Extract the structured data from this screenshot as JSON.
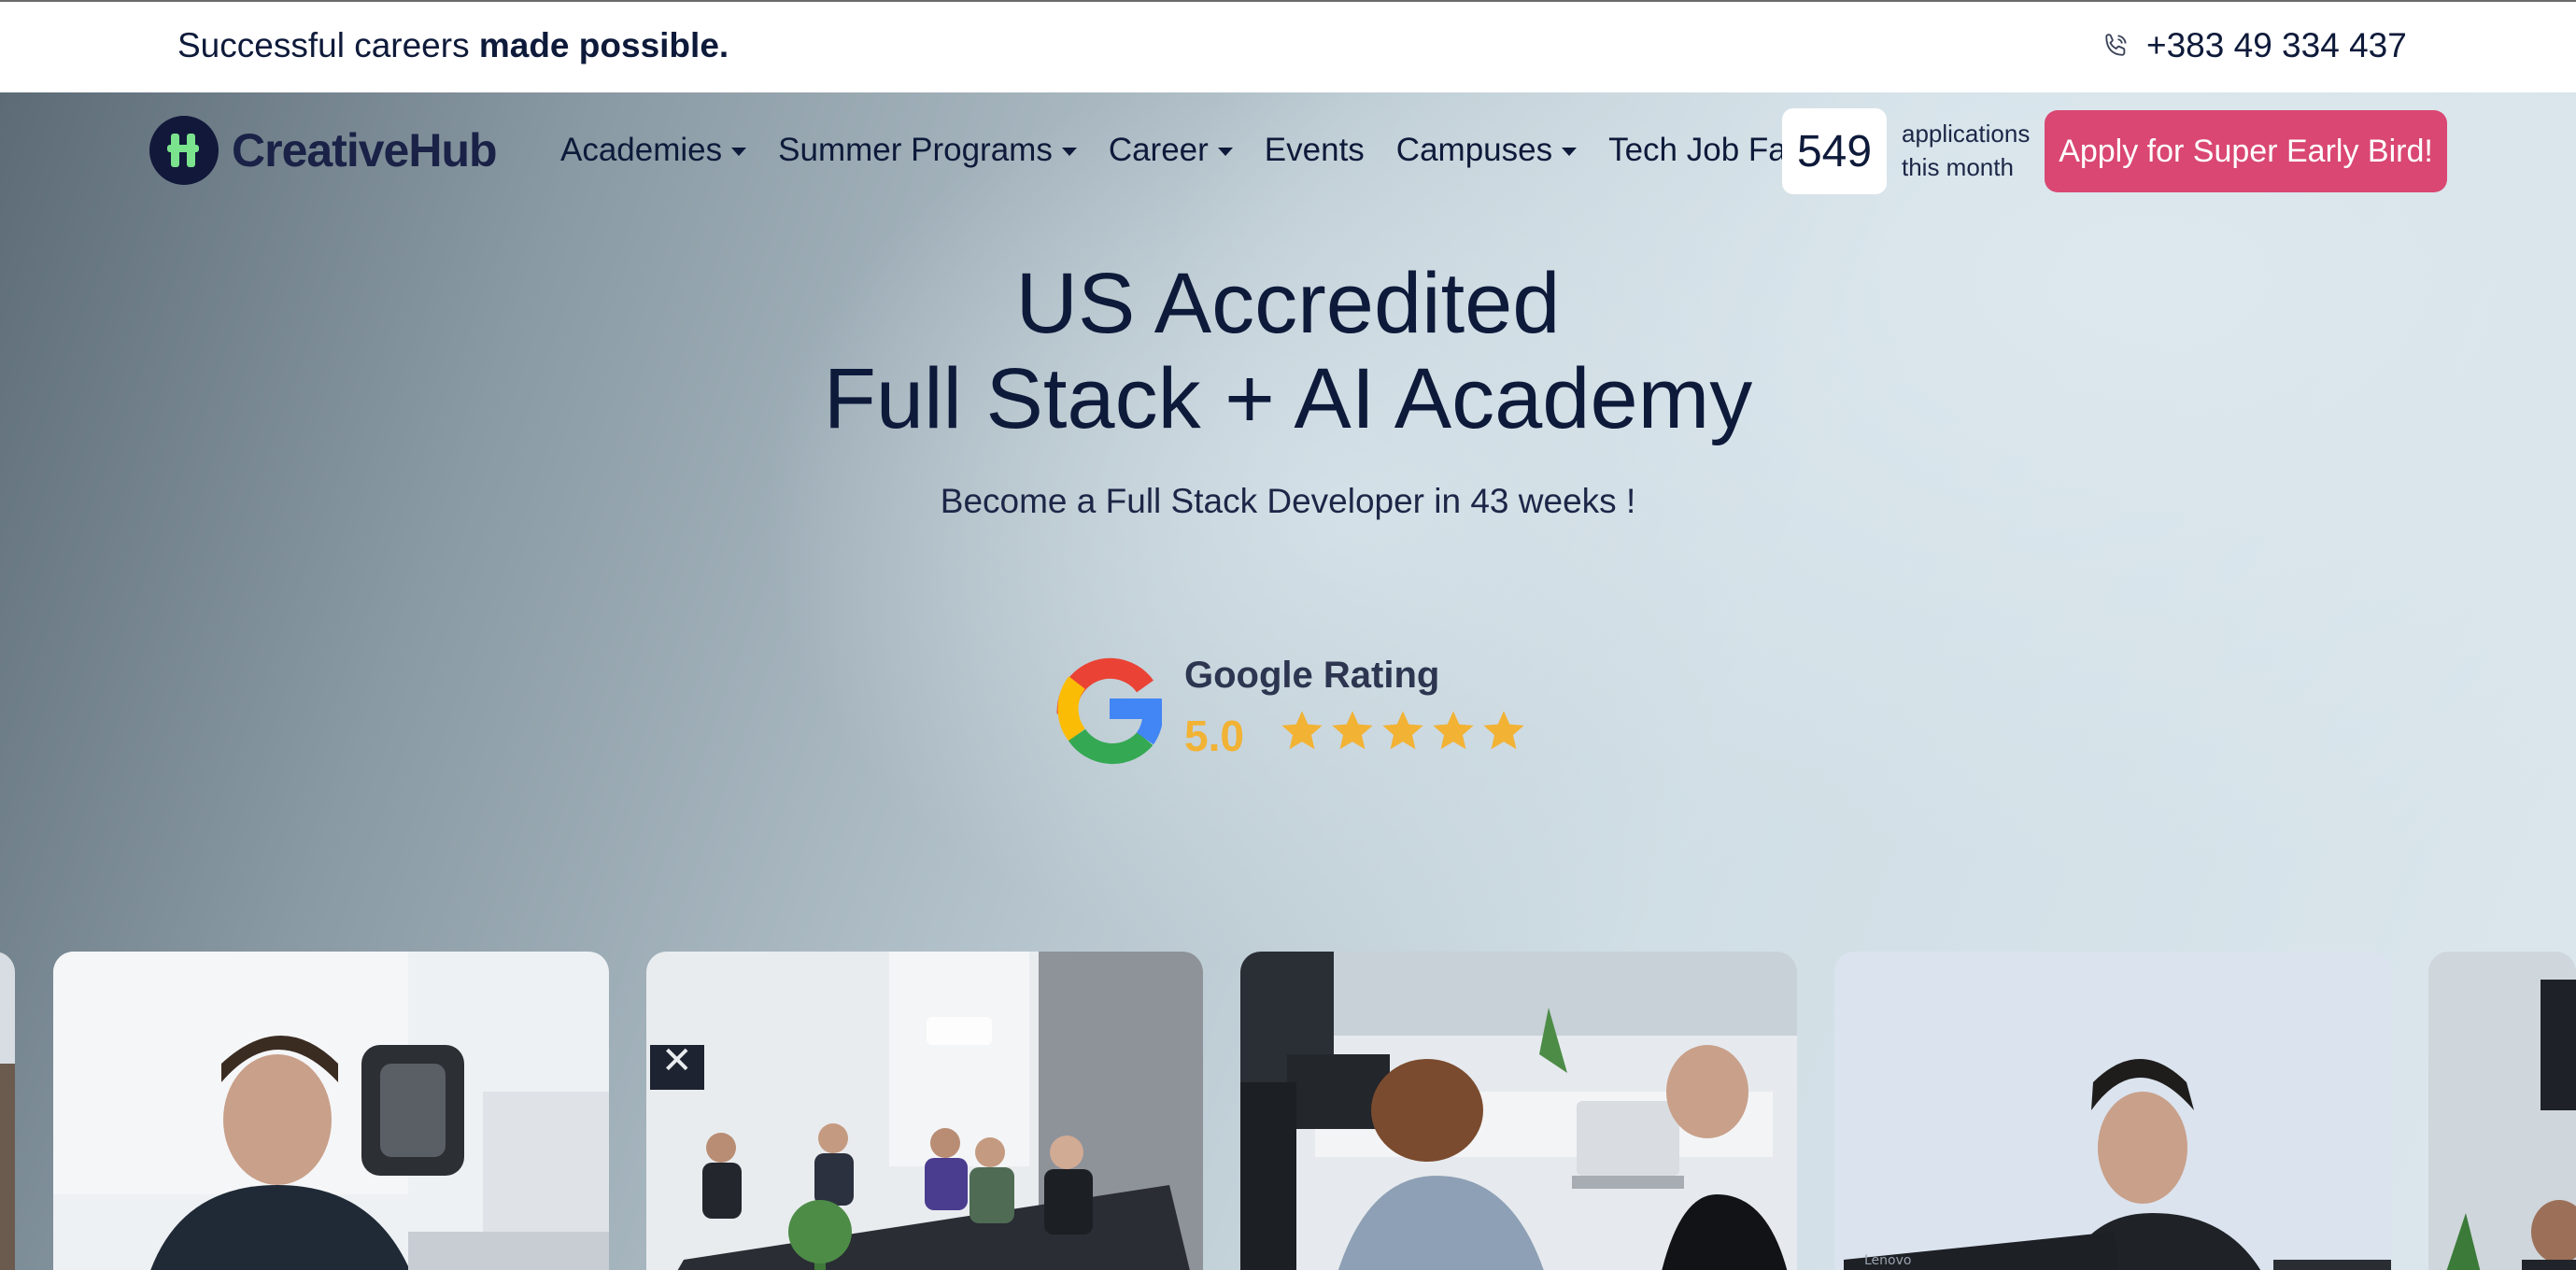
{
  "topbar": {
    "tagline_regular": "Successful careers",
    "tagline_bold": "made possible.",
    "phone": "+383 49 334 437"
  },
  "brand": {
    "name": "CreativeHub",
    "accent": "#d94772",
    "logo_mark_color": "#7be38e",
    "navy": "#0e1a3a"
  },
  "nav": {
    "items": [
      {
        "label": "Academies",
        "dropdown": true
      },
      {
        "label": "Summer Programs",
        "dropdown": true
      },
      {
        "label": "Career",
        "dropdown": true
      },
      {
        "label": "Events",
        "dropdown": false
      },
      {
        "label": "Campuses",
        "dropdown": true
      },
      {
        "label": "Tech Job Fair",
        "dropdown": false
      }
    ]
  },
  "applications": {
    "count": "549",
    "label_line1": "applications",
    "label_line2": "this month"
  },
  "cta": {
    "label": "Apply for Super Early Bird!"
  },
  "hero": {
    "title_line1": "US Accredited",
    "title_line2": "Full Stack + AI Academy",
    "subtitle": "Become a Full Stack Developer in 43 weeks !"
  },
  "rating": {
    "title": "Google Rating",
    "score": "5.0",
    "stars": 5
  },
  "gallery": {
    "photos": [
      {
        "name": "photo-edge-left"
      },
      {
        "name": "photo-developer-at-desk"
      },
      {
        "name": "photo-meeting-room"
      },
      {
        "name": "photo-team-coding"
      },
      {
        "name": "photo-student-thinking"
      },
      {
        "name": "photo-edge-right"
      }
    ]
  }
}
